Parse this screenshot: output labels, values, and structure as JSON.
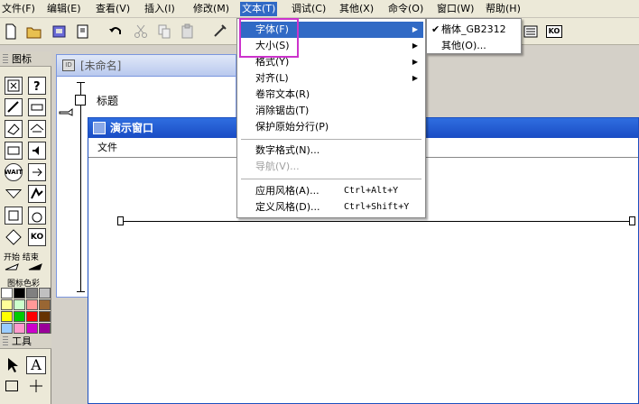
{
  "menubar": {
    "items": [
      {
        "label": "文件(F)"
      },
      {
        "label": "编辑(E)"
      },
      {
        "label": "查看(V)"
      },
      {
        "label": "插入(I)"
      },
      {
        "label": "修改(M)"
      },
      {
        "label": "文本(T)"
      },
      {
        "label": "调试(C)"
      },
      {
        "label": "其他(X)"
      },
      {
        "label": "命令(O)"
      },
      {
        "label": "窗口(W)"
      },
      {
        "label": "帮助(H)"
      }
    ]
  },
  "text_menu": {
    "items": [
      {
        "label": "字体(F)"
      },
      {
        "label": "大小(S)"
      },
      {
        "label": "格式(Y)"
      },
      {
        "label": "对齐(L)"
      },
      {
        "label": "卷帘文本(R)"
      },
      {
        "label": "消除锯齿(T)"
      },
      {
        "label": "保护原始分行(P)"
      },
      {
        "label": "数字格式(N)..."
      },
      {
        "label": "导航(V)..."
      },
      {
        "label": "应用风格(A)...",
        "shortcut": "Ctrl+Alt+Y"
      },
      {
        "label": "定义风格(D)...",
        "shortcut": "Ctrl+Shift+Y"
      }
    ]
  },
  "font_submenu": {
    "items": [
      {
        "label": "楷体_GB2312",
        "checked": true
      },
      {
        "label": "其他(O)..."
      }
    ]
  },
  "palette": {
    "title": "图标",
    "start_end_label": "开始 结束",
    "color_label": "图标色彩",
    "wait_label": "WAIT",
    "ko_label": "KO",
    "colors": [
      "#ffffff",
      "#000000",
      "#808080",
      "#c0c0c0",
      "#ffff99",
      "#ccffcc",
      "#ff9999",
      "#996633",
      "#ffff00",
      "#00cc00",
      "#ff0000",
      "#663300",
      "#99ccff",
      "#ff99cc",
      "#cc00cc",
      "#990099",
      "#3366ff",
      "#0000cc",
      "#6600cc",
      "#003399"
    ]
  },
  "tools": {
    "title": "工具"
  },
  "flow_window": {
    "title": "[未命名]",
    "icon_label": "标题"
  },
  "present_window": {
    "title": "演示窗口",
    "menu_file": "文件"
  },
  "toolbar": {
    "ko_label": "KO"
  }
}
